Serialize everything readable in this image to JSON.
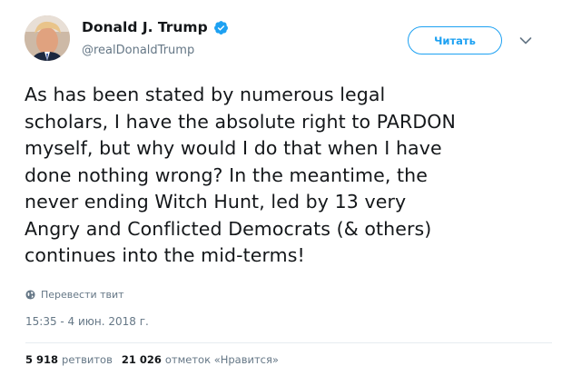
{
  "profile": {
    "name": "Donald J. Trump",
    "handle": "@realDonaldTrump",
    "verified_color": "#1da1f2"
  },
  "follow_button": {
    "label": "Читать"
  },
  "tweet": {
    "lines": [
      "As has been stated by numerous legal",
      "scholars, I have the absolute right to PARDON",
      "myself, but why would I do that when I have",
      "done nothing wrong? In the meantime, the",
      "never ending Witch Hunt, led by 13 very",
      "Angry and Conflicted Democrats (& others)",
      "continues into the mid-terms!"
    ]
  },
  "translate": {
    "label": "Перевести твит",
    "icon": "globe-icon"
  },
  "timestamp": "15:35 - 4 июн. 2018 г.",
  "stats": {
    "retweets_count": "5 918",
    "retweets_label": "ретвитов",
    "likes_count": "21 026",
    "likes_label": "отметок «Нравится»"
  },
  "colors": {
    "accent": "#1da1f2",
    "text": "#14171a",
    "secondary": "#657786",
    "divider": "#e6ecf0"
  }
}
